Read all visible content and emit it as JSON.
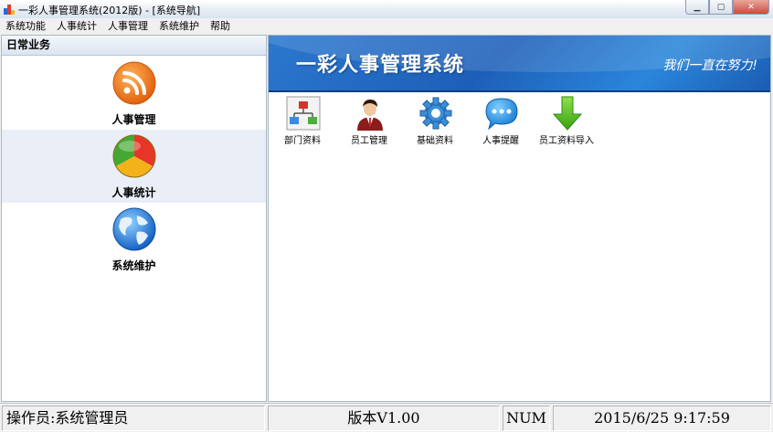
{
  "window": {
    "title": "一彩人事管理系统(2012版) - [系统导航]",
    "controls": [
      "minimize-icon",
      "maximize-icon",
      "close-icon"
    ]
  },
  "menu": [
    "系统功能",
    "人事统计",
    "人事管理",
    "系统维护",
    "帮助"
  ],
  "left_panel": {
    "header": "日常业务",
    "items": [
      {
        "label": "人事管理",
        "icon": "rss-orange-icon"
      },
      {
        "label": "人事统计",
        "icon": "pie-chart-icon"
      },
      {
        "label": "系统维护",
        "icon": "globe-icon"
      }
    ]
  },
  "banner": {
    "title": "一彩人事管理系统",
    "slogan": "我们一直在努力!"
  },
  "tools": [
    {
      "label": "部门资料",
      "icon": "org-chart-icon"
    },
    {
      "label": "员工管理",
      "icon": "employee-icon"
    },
    {
      "label": "基础资料",
      "icon": "gear-icon"
    },
    {
      "label": "人事提醒",
      "icon": "chat-bubble-icon"
    },
    {
      "label": "员工资料导入",
      "icon": "down-arrow-icon"
    }
  ],
  "status": {
    "operator": "操作员:系统管理员",
    "version": "版本V1.00",
    "numlock": "NUM",
    "datetime": "2015/6/25 9:17:59"
  },
  "colors": {
    "banner_blue": "#1d5fb8",
    "selection": "#e9eef7"
  }
}
